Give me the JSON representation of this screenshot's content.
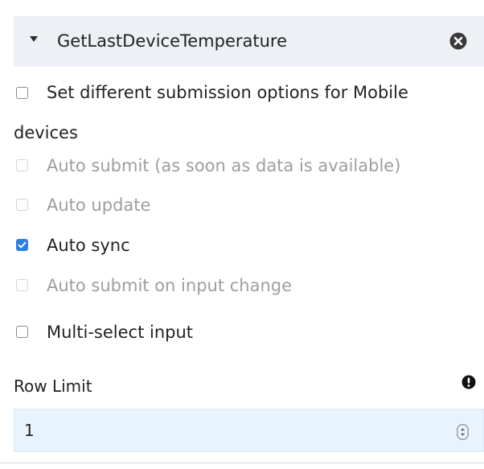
{
  "panel": {
    "title": "GetLastDeviceTemperature"
  },
  "options": {
    "mobile_options_label": "Set different submission options for Mobile devices",
    "mobile_options_checked": false,
    "auto_submit_label": "Auto submit (as soon as data is available)",
    "auto_submit_checked": false,
    "auto_update_label": "Auto update",
    "auto_update_checked": false,
    "auto_sync_label": "Auto sync",
    "auto_sync_checked": true,
    "auto_submit_input_label": "Auto submit on input change",
    "auto_submit_input_checked": false,
    "multi_select_label": "Multi-select input",
    "multi_select_checked": false
  },
  "row_limit": {
    "label": "Row Limit",
    "value": "1"
  },
  "icons": {
    "collapse": "caret-down-icon",
    "close": "close-circle-icon",
    "warning": "exclamation-circle-icon",
    "spinner": "up-down-spinner-icon"
  },
  "colors": {
    "header_bg": "#edf0f4",
    "checkbox_checked": "#2f7ee0",
    "input_bg": "#e8f4fd",
    "disabled_text": "#9e9e9e"
  }
}
